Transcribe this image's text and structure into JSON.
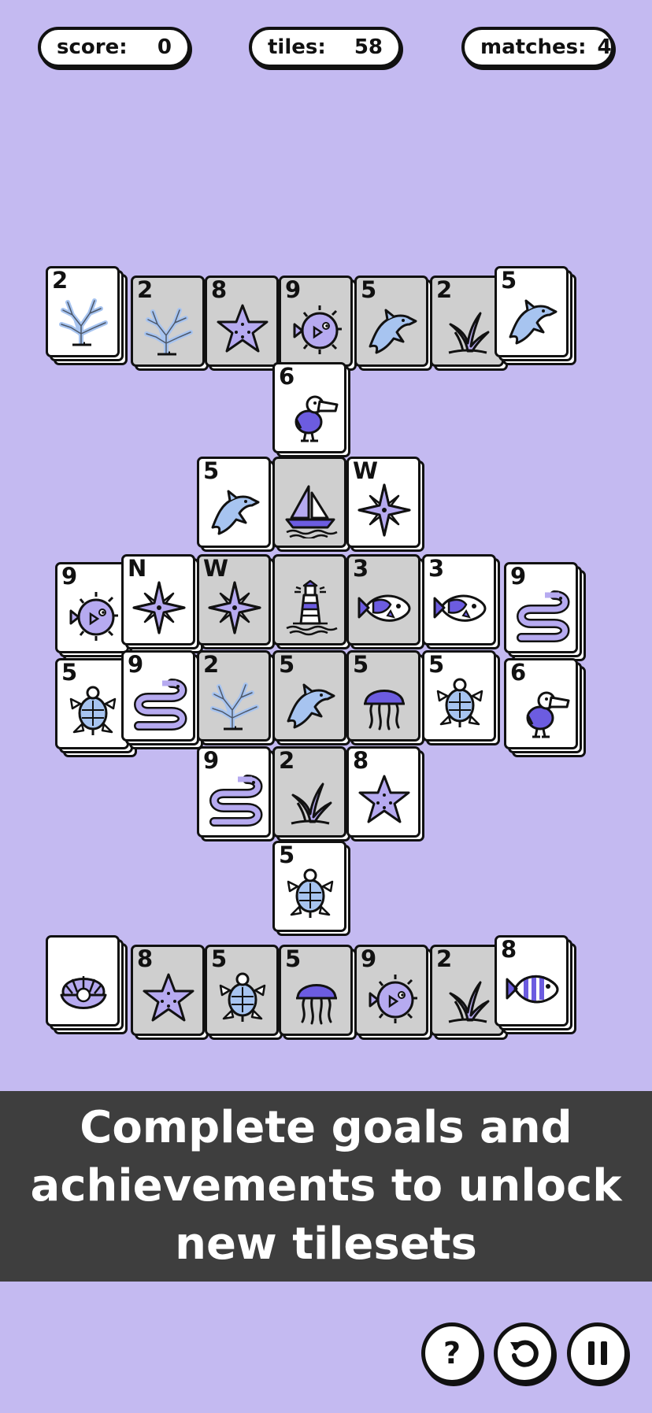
{
  "hud": {
    "score_label": "score:",
    "score_value": "0",
    "tiles_label": "tiles:",
    "tiles_value": "58",
    "matches_label": "matches:",
    "matches_value": "4"
  },
  "banner": {
    "text": "Complete goals and achievements to unlock new tilesets"
  },
  "controls": {
    "help_icon": "question-mark-icon",
    "restart_icon": "restart-icon",
    "pause_icon": "pause-icon"
  },
  "colors": {
    "background": "#c4baf1",
    "tile_face": "#ffffff",
    "tile_blocked": "#cfcfcf",
    "banner": "#3e3e3e",
    "icon_light": "#a7c4f0",
    "icon_lilac": "#b6aaf0",
    "icon_purple": "#6c5ce0"
  },
  "tiles": [
    {
      "label": "2",
      "icon": "coral",
      "blocked": false
    },
    {
      "label": "2",
      "icon": "coral",
      "blocked": true
    },
    {
      "label": "8",
      "icon": "starfish",
      "blocked": true
    },
    {
      "label": "9",
      "icon": "pufferfish",
      "blocked": true
    },
    {
      "label": "5",
      "icon": "dolphin",
      "blocked": true
    },
    {
      "label": "2",
      "icon": "seaweed",
      "blocked": true
    },
    {
      "label": "5",
      "icon": "dolphin",
      "blocked": false
    },
    {
      "label": "6",
      "icon": "pelican",
      "blocked": false
    },
    {
      "label": "5",
      "icon": "dolphin",
      "blocked": false
    },
    {
      "label": "",
      "icon": "sailboat",
      "blocked": true
    },
    {
      "label": "W",
      "icon": "compass",
      "blocked": false
    },
    {
      "label": "9",
      "icon": "pufferfish",
      "blocked": false
    },
    {
      "label": "N",
      "icon": "compass",
      "blocked": false
    },
    {
      "label": "W",
      "icon": "compass",
      "blocked": true
    },
    {
      "label": "",
      "icon": "lighthouse",
      "blocked": true
    },
    {
      "label": "3",
      "icon": "fish",
      "blocked": true
    },
    {
      "label": "3",
      "icon": "fish",
      "blocked": false
    },
    {
      "label": "9",
      "icon": "eel",
      "blocked": false
    },
    {
      "label": "5",
      "icon": "turtle",
      "blocked": false
    },
    {
      "label": "9",
      "icon": "eel",
      "blocked": false
    },
    {
      "label": "2",
      "icon": "coral",
      "blocked": true
    },
    {
      "label": "5",
      "icon": "dolphin",
      "blocked": true
    },
    {
      "label": "5",
      "icon": "jellyfish",
      "blocked": true
    },
    {
      "label": "5",
      "icon": "turtle",
      "blocked": false
    },
    {
      "label": "6",
      "icon": "pelican",
      "blocked": false
    },
    {
      "label": "9",
      "icon": "eel",
      "blocked": false
    },
    {
      "label": "2",
      "icon": "seaweed",
      "blocked": true
    },
    {
      "label": "8",
      "icon": "starfish",
      "blocked": false
    },
    {
      "label": "5",
      "icon": "turtle",
      "blocked": false
    },
    {
      "label": "",
      "icon": "clam",
      "blocked": false
    },
    {
      "label": "8",
      "icon": "starfish",
      "blocked": true
    },
    {
      "label": "5",
      "icon": "turtle",
      "blocked": true
    },
    {
      "label": "5",
      "icon": "jellyfish",
      "blocked": true
    },
    {
      "label": "9",
      "icon": "pufferfish",
      "blocked": true
    },
    {
      "label": "2",
      "icon": "seaweed",
      "blocked": true
    },
    {
      "label": "8",
      "icon": "fish-striped",
      "blocked": false
    }
  ]
}
